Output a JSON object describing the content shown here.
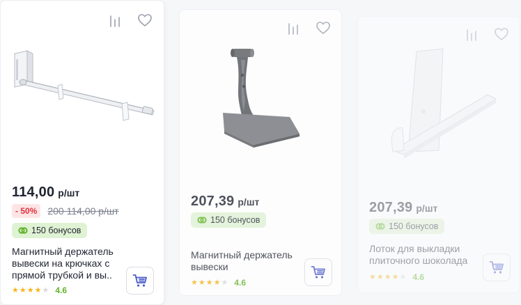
{
  "colors": {
    "accent": "#4a5bc9",
    "bonus_bg": "#dff2d3",
    "bonus_icon": "#62b32a",
    "discount_text": "#e0323c",
    "discount_bg": "#fde5e6",
    "star": "#f6b51e",
    "rating_text": "#62b32a"
  },
  "products": [
    {
      "price": "114,00",
      "unit": "р/шт",
      "discount": "- 50%",
      "old_price": "200 114,00 р/шт",
      "bonus": "150 бонусов",
      "name": "Магнитный держатель вывески на крючках с прямой трубкой и вы..",
      "rating_value": "4.6",
      "rating_stars": 4,
      "icons": [
        "compare-icon",
        "heart-icon",
        "cart-icon",
        "bonus-icon"
      ]
    },
    {
      "price": "207,39",
      "unit": "р/шт",
      "bonus": "150 бонусов",
      "name": "Магнитный держатель вывески",
      "rating_value": "4.6",
      "rating_stars": 4,
      "icons": [
        "compare-icon",
        "heart-icon",
        "cart-icon",
        "bonus-icon"
      ]
    },
    {
      "price": "207,39",
      "unit": "р/шт",
      "bonus": "150 бонусов",
      "name": "Лоток для выкладки плиточного шоколада",
      "rating_value": "4.6",
      "rating_stars": 4,
      "icons": [
        "compare-icon",
        "heart-icon",
        "cart-icon",
        "bonus-icon"
      ]
    }
  ]
}
